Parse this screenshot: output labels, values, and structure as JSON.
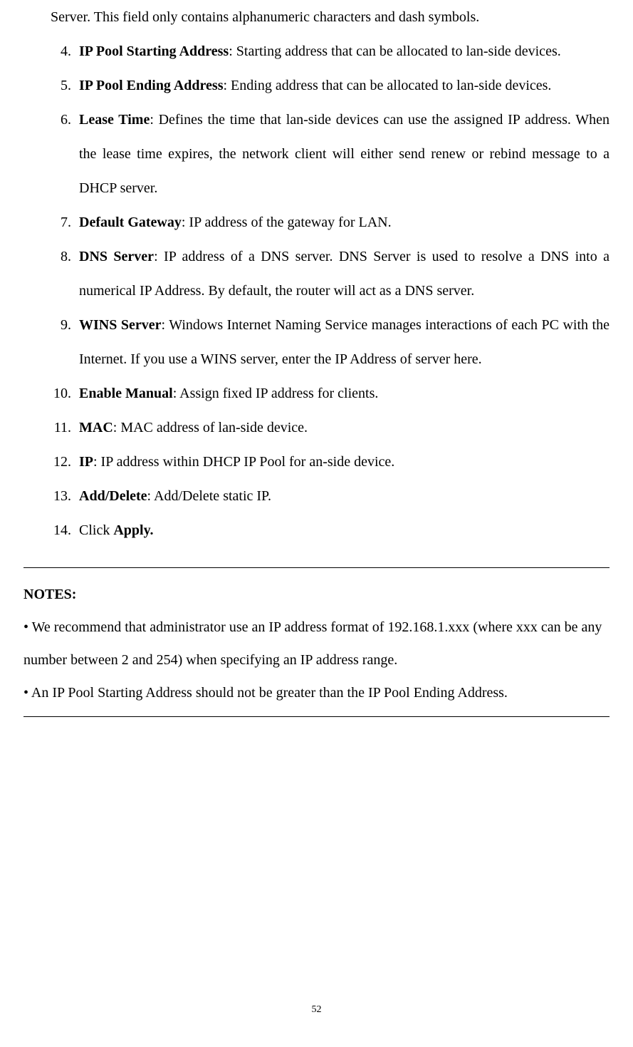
{
  "fragment_top": "Server. This field only contains alphanumeric characters and dash symbols.",
  "list_start": 4,
  "items": [
    {
      "term": "IP Pool Starting Address",
      "desc": ": Starting address that can be allocated to lan-side devices."
    },
    {
      "term": "IP Pool Ending Address",
      "desc": ": Ending address that can be allocated to lan-side devices."
    },
    {
      "term": "Lease Time",
      "desc": ": Defines the time that lan-side devices can use the assigned IP address. When the lease time expires, the network client will either send renew or rebind message to a DHCP server."
    },
    {
      "term": "Default Gateway",
      "desc": ": IP address of the gateway for LAN."
    },
    {
      "term": "DNS Server",
      "desc": ": IP address of a DNS server. DNS Server is used to resolve a DNS into a numerical IP Address. By default, the router will act as a DNS server."
    },
    {
      "term": "WINS Server",
      "desc": ": Windows Internet Naming Service manages interactions of each PC with the Internet. If you use a WINS server, enter the IP Address of server here."
    },
    {
      "term": "Enable Manual",
      "desc": ": Assign fixed IP address for clients."
    },
    {
      "term": "MAC",
      "desc": ": MAC address of lan-side device."
    },
    {
      "term": "IP",
      "desc": ": IP address within DHCP IP Pool for an-side device."
    },
    {
      "term": "Add/Delete",
      "desc": ": Add/Delete static IP."
    },
    {
      "prefix": "Click ",
      "term": "Apply.",
      "desc": ""
    }
  ],
  "notes": {
    "heading": "NOTES:",
    "bullets": [
      "• We recommend that administrator use an IP address format of 192.168.1.xxx (where xxx can be any number between 2 and 254) when specifying an IP address range.",
      "• An IP Pool Starting Address should not be greater than the IP Pool Ending Address."
    ]
  },
  "page_number": "52"
}
